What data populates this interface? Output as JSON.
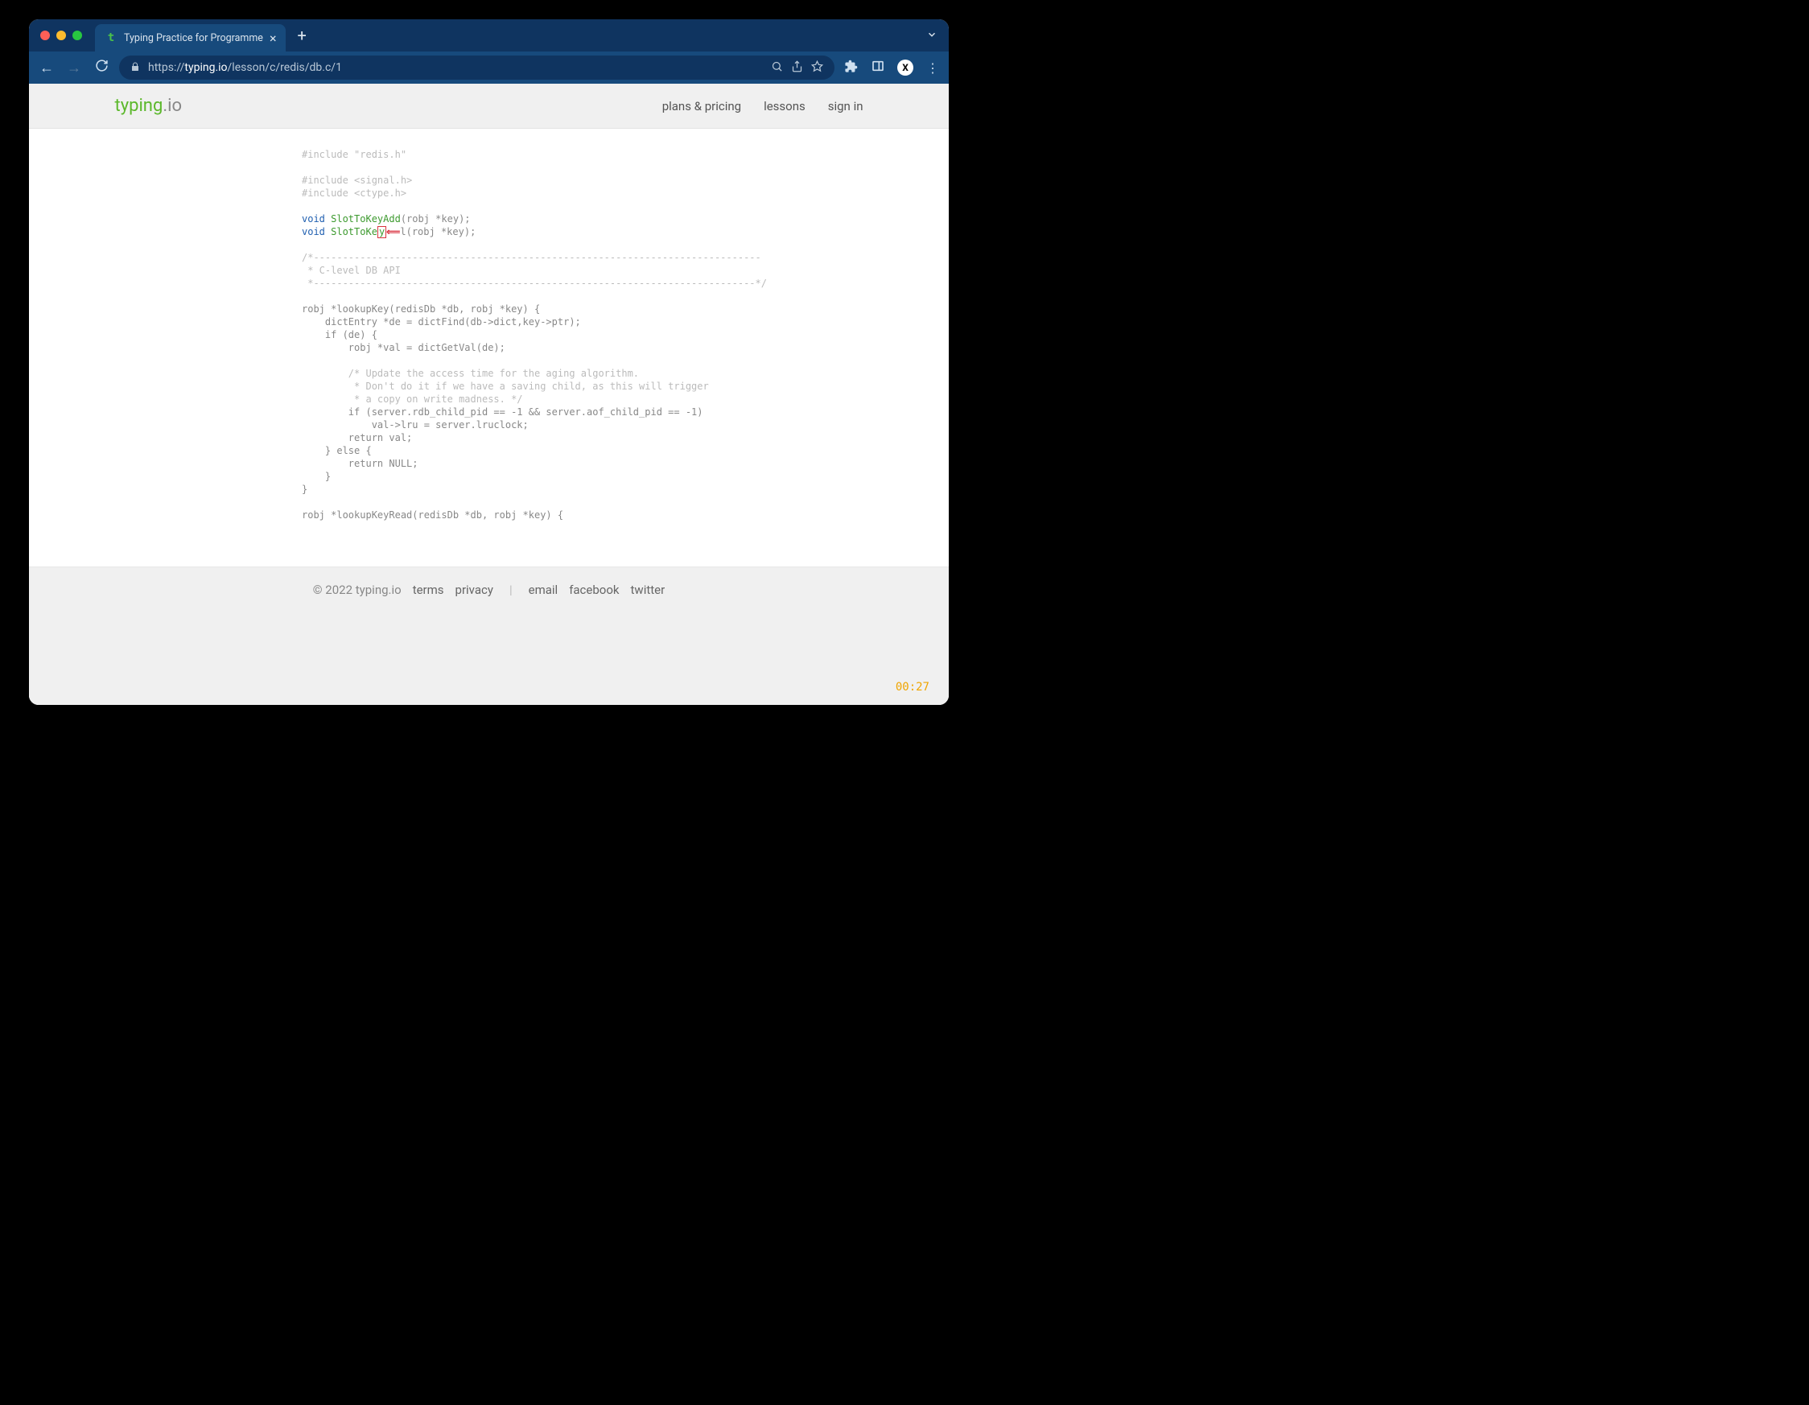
{
  "browser": {
    "tab_title": "Typing Practice for Programme",
    "tab_favicon": "t",
    "url_prefix": "https://",
    "url_host": "typing.io",
    "url_path": "/lesson/c/redis/db.c/1"
  },
  "site": {
    "logo_green": "typing",
    "logo_grey": ".io",
    "nav": {
      "plans": "plans & pricing",
      "lessons": "lessons",
      "signin": "sign in"
    }
  },
  "code": {
    "l1": "#include \"redis.h\"",
    "l2": "",
    "l3": "#include <signal.h>",
    "l4": "#include <ctype.h>",
    "l5": "",
    "l6_kw": "void",
    "l6_fn": " SlotToKeyAdd",
    "l6_rest": "(robj *key);",
    "l7_kw": "void",
    "l7_fn_pre": " SlotToKe",
    "l7_cursor": "y",
    "l7_arrow": "⟸",
    "l7_rest": "l(robj *key);",
    "l8": "",
    "l9": "/*-----------------------------------------------------------------------------",
    "l10": " * C-level DB API",
    "l11": " *----------------------------------------------------------------------------*/",
    "l12": "",
    "l13": "robj *lookupKey(redisDb *db, robj *key) {",
    "l14": "    dictEntry *de = dictFind(db->dict,key->ptr);",
    "l15": "    if (de) {",
    "l16": "        robj *val = dictGetVal(de);",
    "l17": "",
    "l18": "        /* Update the access time for the aging algorithm.",
    "l19": "         * Don't do it if we have a saving child, as this will trigger",
    "l20": "         * a copy on write madness. */",
    "l21": "        if (server.rdb_child_pid == -1 && server.aof_child_pid == -1)",
    "l22": "            val->lru = server.lruclock;",
    "l23": "        return val;",
    "l24": "    } else {",
    "l25": "        return NULL;",
    "l26": "    }",
    "l27": "}",
    "l28": "",
    "l29": "robj *lookupKeyRead(redisDb *db, robj *key) {"
  },
  "footer": {
    "copyright": "© 2022 typing.io",
    "terms": "terms",
    "privacy": "privacy",
    "sep": "|",
    "email": "email",
    "facebook": "facebook",
    "twitter": "twitter"
  },
  "timer": "00:27",
  "avatar": "X"
}
